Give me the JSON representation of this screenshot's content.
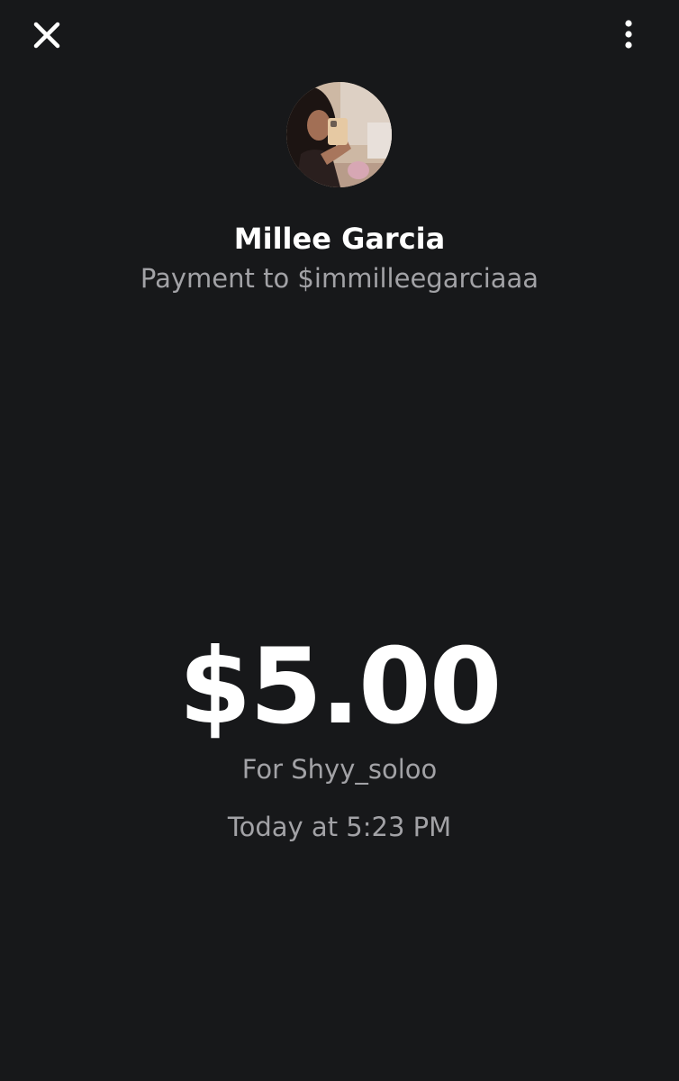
{
  "header": {
    "close_icon": "close-icon",
    "more_icon": "more-vertical-icon"
  },
  "recipient": {
    "name": "Millee Garcia",
    "subtitle": "Payment to $immilleegarciaaa",
    "avatar": "profile-photo"
  },
  "payment": {
    "amount": "$5.00",
    "note": "For Shyy_soloo",
    "timestamp": "Today at 5:23 PM"
  },
  "colors": {
    "background": "#17181a",
    "primary_text": "#ffffff",
    "secondary_text": "#a2a2a6"
  }
}
